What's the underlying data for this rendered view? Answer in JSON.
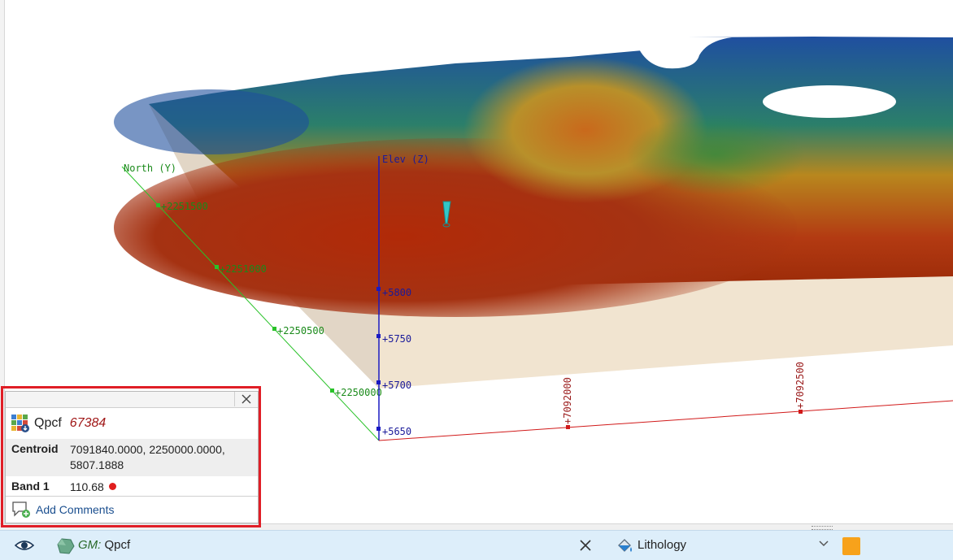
{
  "scene": {
    "axes": {
      "north_label": "North (Y)",
      "elev_label": "Elev (Z)",
      "north_ticks": [
        "+2251500",
        "+2251000",
        "+2250500",
        "+2250000"
      ],
      "elev_ticks": [
        "+5800",
        "+5750",
        "+5700",
        "+5650"
      ],
      "east_ticks": [
        "+7092000",
        "+7092500"
      ]
    }
  },
  "info_panel": {
    "object_name": "Qpcf",
    "object_id": "67384",
    "rows": [
      {
        "key": "Centroid",
        "value": "7091840.0000, 2250000.0000, 5807.1888"
      },
      {
        "key": "Band 1",
        "value": "110.68"
      }
    ],
    "add_comments": "Add Comments",
    "band_dot_color": "#e01e1e"
  },
  "status_bar": {
    "gm_prefix": "GM:",
    "gm_name": "Qpcf",
    "lithology": "Lithology",
    "swatch_color": "#f7a21b"
  },
  "icons": [
    "eye-icon",
    "geo-model-icon",
    "close-icon",
    "paint-bucket-icon",
    "chevron-down-icon",
    "comment-add-icon",
    "surface-object-icon"
  ]
}
